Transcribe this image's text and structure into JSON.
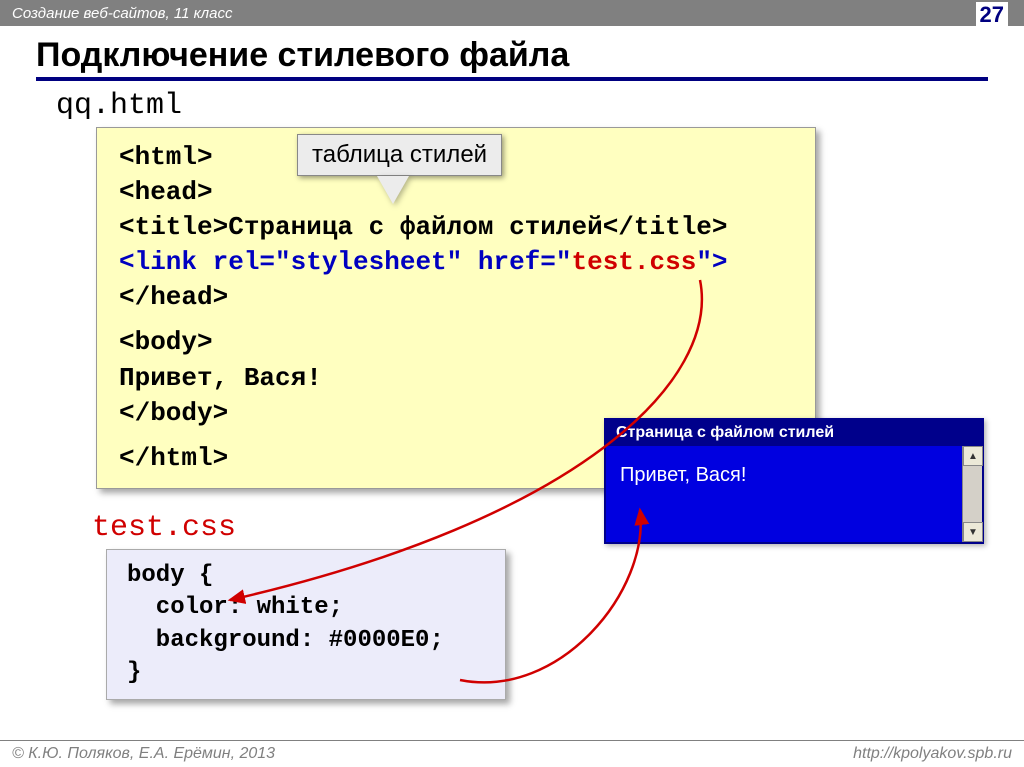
{
  "header": {
    "subject": "Создание веб-сайтов, 11 класс",
    "page": "27"
  },
  "title": "Подключение стилевого файла",
  "files": {
    "html_name": "qq.html",
    "css_name": "test.css"
  },
  "callout": {
    "label": "таблица стилей"
  },
  "html_code": {
    "l1": "<html>",
    "l2": "<head>",
    "l3a": "<title>",
    "l3b": "Страница с файлом стилей",
    "l3c": "</title>",
    "l4a": "<link rel=\"stylesheet\" href=\"",
    "l4b": "test.css",
    "l4c": "\">",
    "l5": "</head>",
    "l6": "<body>",
    "l7": "Привет, Вася!",
    "l8": "</body>",
    "l9": "</html>"
  },
  "css_code": {
    "l1": "body {",
    "l2": "  color: white;",
    "l3": "  background: #0000E0;",
    "l4": "}"
  },
  "result": {
    "title": "Страница с файлом стилей",
    "body": "Привет, Вася!"
  },
  "footer": {
    "copyright": " К.Ю. Поляков, Е.А. Ерёмин, 2013",
    "url": "http://kpolyakov.spb.ru"
  }
}
